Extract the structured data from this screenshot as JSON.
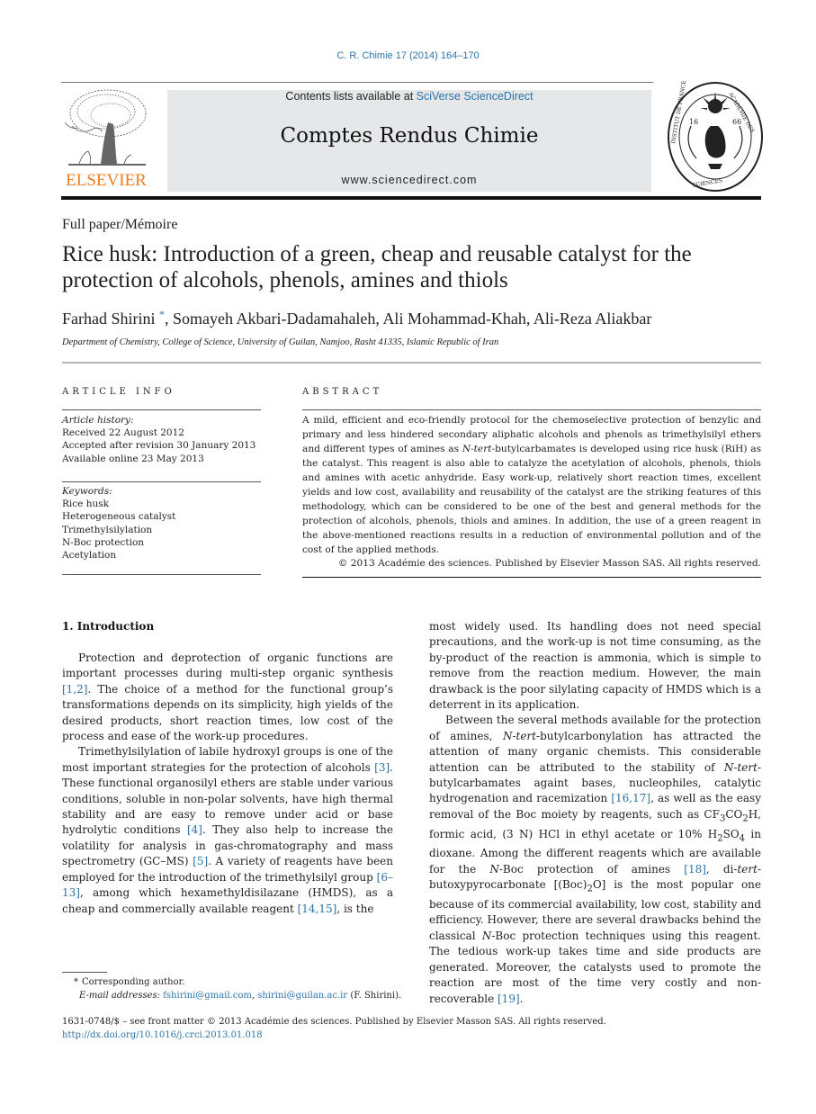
{
  "header": {
    "journal_ref": "C. R. Chimie 17 (2014) 164–170",
    "contents_prefix": "Contents lists available at ",
    "contents_link": "SciVerse ScienceDirect",
    "journal_title": "Comptes Rendus Chimie",
    "journal_url": "www.sciencedirect.com",
    "publisher_logo_text": "ELSEVIER",
    "publisher_logo_icon": "elsevier-tree-logo",
    "society_logo_icon": "institut-de-france-seal",
    "society_logo_text_top": "INSTITUT DE FRANCE · ACADÉMIE DES SCIENCES",
    "society_logo_years": [
      "16",
      "66"
    ]
  },
  "article": {
    "type": "Full paper/Mémoire",
    "title": "Rice husk: Introduction of a green, cheap and reusable catalyst for the protection of alcohols, phenols, amines and thiols",
    "authors": [
      {
        "name": "Farhad Shirini",
        "corresponding_mark": "*"
      },
      {
        "name": "Somayeh Akbari-Dadamahaleh"
      },
      {
        "name": "Ali Mohammad-Khah"
      },
      {
        "name": "Ali-Reza Aliakbar"
      }
    ],
    "affiliation": "Department of Chemistry, College of Science, University of Guilan, Namjoo, Rasht 41335, Islamic Republic of Iran"
  },
  "article_info": {
    "heading": "ARTICLE INFO",
    "history_label": "Article history:",
    "history": [
      "Received 22 August 2012",
      "Accepted after revision 30 January 2013",
      "Available online 23 May 2013"
    ],
    "keywords_label": "Keywords:",
    "keywords": [
      "Rice husk",
      "Heterogeneous catalyst",
      "Trimethylsilylation",
      "N-Boc protection",
      "Acetylation"
    ]
  },
  "abstract": {
    "heading": "ABSTRACT",
    "text_1": "A mild, efficient and eco-friendly protocol for the chemoselective protection of benzylic and primary and less hindered secondary aliphatic alcohols and phenols as trimethylsilyl ethers and different types of amines as ",
    "text_ital": "N-tert",
    "text_2": "-butylcarbamates is developed using rice husk (RiH) as the catalyst. This reagent is also able to catalyze the acetylation of alcohols, phenols, thiols and amines with acetic anhydride. Easy work-up, relatively short reaction times, excellent yields and low cost, availability and reusability of the catalyst are the striking features of this methodology, which can be considered to be one of the best and general methods for the protection of alcohols, phenols, thiols and amines. In addition, the use of a green reagent in the above-mentioned reactions results in a reduction of environmental pollution and of the cost of the applied methods.",
    "copyright": "© 2013 Académie des sciences. Published by Elsevier Masson SAS. All rights reserved."
  },
  "introduction": {
    "heading": "1. Introduction",
    "left": {
      "p1_a": "Protection and deprotection of organic functions are important processes during multi-step organic synthesis ",
      "p1_ref": "[1,2]",
      "p1_b": ". The choice of a method for the functional group’s transformations depends on its simplicity, high yields of the desired products, short reaction times, low cost of the process and ease of the work-up procedures.",
      "p2_a": "Trimethylsilylation of labile hydroxyl groups is one of the most important strategies for the protection of alcohols ",
      "p2_ref1": "[3]",
      "p2_b": ". These functional organosilyl ethers are stable under various conditions, soluble in non-polar solvents, have high thermal stability and are easy to remove under acid or base hydrolytic conditions ",
      "p2_ref2": "[4]",
      "p2_c": ". They also help to increase the volatility for analysis in gas-chromatography and mass spectrometry (GC–MS) ",
      "p2_ref3": "[5]",
      "p2_d": ". A variety of reagents have been employed for the introduction of the trimethylsilyl group ",
      "p2_ref4": "[6–13]",
      "p2_e": ", among which hexamethyldisilazane (HMDS), as a cheap and commercially available reagent ",
      "p2_ref5": "[14,15]",
      "p2_f": ", is the"
    },
    "right": {
      "p1": "most widely used. Its handling does not need special precautions, and the work-up is not time consuming, as the by-product of the reaction is ammonia, which is simple to remove from the reaction medium. However, the main drawback is the poor silylating capacity of HMDS which is a deterrent in its application.",
      "p2_a": "Between the several methods available for the protection of amines, ",
      "p2_i1": "N-tert",
      "p2_b": "-butylcarbonylation has attracted the attention of many organic chemists. This considerable attention can be attributed to the stability of ",
      "p2_i2": "N-tert",
      "p2_c": "-butylcarbamates againt bases, nucleophiles, catalytic hydrogenation and racemization ",
      "p2_ref1": "[16,17]",
      "p2_d": ", as well as the easy removal of the Boc moiety by reagents, such as CF",
      "p2_sub1": "3",
      "p2_e": "CO",
      "p2_sub2": "2",
      "p2_f": "H, formic acid, (3 N) HCl in ethyl acetate or 10% H",
      "p2_sub3": "2",
      "p2_g": "SO",
      "p2_sub4": "4",
      "p2_h": " in dioxane. Among the different reagents which are available for the ",
      "p2_i3": "N",
      "p2_i": "-Boc protection of amines ",
      "p2_ref2": "[18]",
      "p2_j": ", di-",
      "p2_i4": "tert",
      "p2_k": "-butoxypyrocarbonate [(Boc)",
      "p2_sub5": "2",
      "p2_l": "O] is the most popular one because of its commercial availability, low cost, stability and efficiency. However, there are several drawbacks behind the classical ",
      "p2_i5": "N",
      "p2_m": "-Boc protection techniques using this reagent. The tedious work-up takes time and side products are generated. Moreover, the catalysts used to promote the reaction are most of the time very costly and non-recoverable ",
      "p2_ref3": "[19]",
      "p2_n": "."
    }
  },
  "footnote": {
    "mark": "*",
    "corresponding": "Corresponding author.",
    "email_label": "E-mail addresses:",
    "email_1": "fshirini@gmail.com",
    "separator": ", ",
    "email_2": "shirini@guilan.ac.ir",
    "email_owner": " (F. Shirini)."
  },
  "front_matter": {
    "issn_line": "1631-0748/$ – see front matter © 2013 Académie des sciences. Published by Elsevier Masson SAS. All rights reserved.",
    "doi": "http://dx.doi.org/10.1016/j.crci.2013.01.018"
  },
  "colors": {
    "link": "#2a73a7",
    "elsevier_orange": "#f07d22",
    "header_box": "#e6e7e8"
  }
}
